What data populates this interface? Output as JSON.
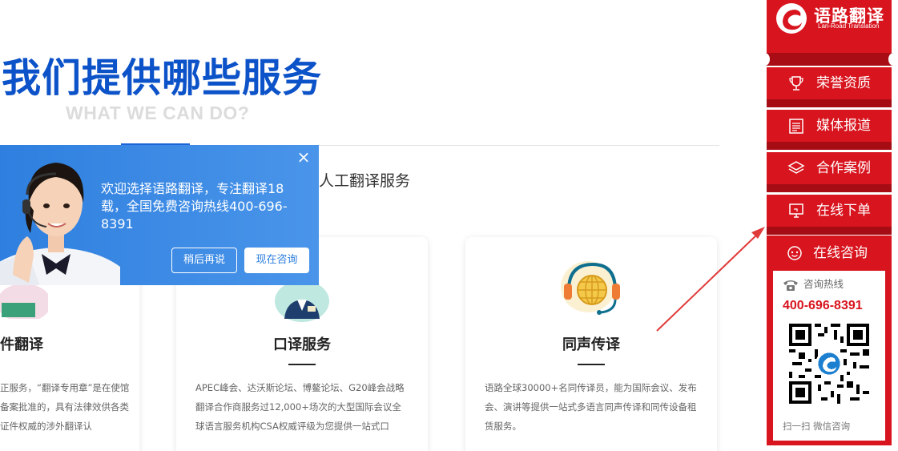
{
  "section": {
    "title": "我们提供哪些服务",
    "subtitle": "WHAT WE CAN DO?",
    "tab_right_text": "人工翻译服务"
  },
  "cards": [
    {
      "title": "件翻译",
      "desc": "正服务，“翻译专用章”是在使馆备案批准的，具有法律效供各类证件权威的涉外翻译认"
    },
    {
      "title": "口译服务",
      "desc": "APEC峰会、达沃斯论坛、博鳌论坛、G20峰会战略翻译合作商服务过12,000+场次的大型国际会议全球语言服务机构CSA权威评级为您提供一站式口"
    },
    {
      "title": "同声传译",
      "desc": "语路全球30000+名同传译员，能为国际会议、发布会、演讲等提供一站式多语言同声传译和同传设备租赁服务。"
    }
  ],
  "popup": {
    "close_symbol": "×",
    "message": "欢迎选择语路翻译，专注翻译18载，全国免费咨询热线400-696-8391",
    "later_button": "稍后再说",
    "consult_button": "现在咨询"
  },
  "sidebar": {
    "logo_cn": "语路翻译",
    "logo_en": "Lan-Road Translation",
    "items": [
      {
        "label": "荣誉资质",
        "icon": "trophy-icon"
      },
      {
        "label": "媒体报道",
        "icon": "news-icon"
      },
      {
        "label": "合作案例",
        "icon": "layers-icon"
      },
      {
        "label": "在线下单",
        "icon": "monitor-order-icon"
      }
    ],
    "consult": {
      "label": "在线咨询",
      "hotline_label": "咨询热线",
      "hotline_number": "400-696-8391",
      "qr_caption": "扫一扫 微信咨询"
    }
  },
  "colors": {
    "brand_red": "#d8141e",
    "brand_blue": "#0c52c8",
    "popup_blue": "#2e7fdf"
  }
}
